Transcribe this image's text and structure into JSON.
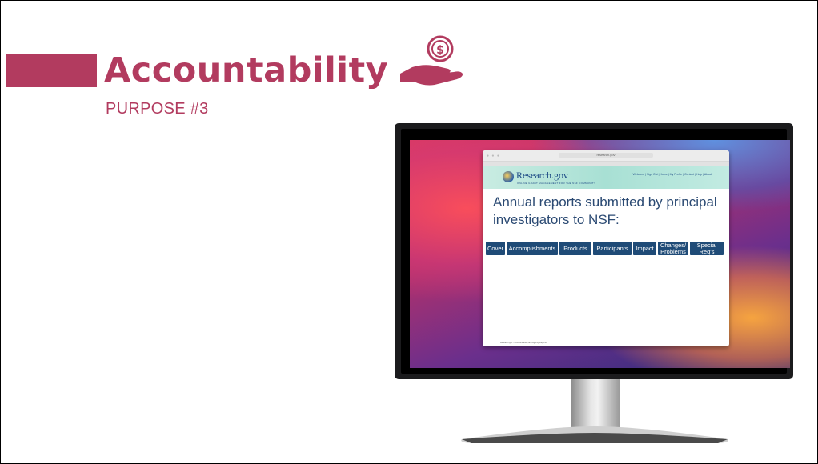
{
  "slide": {
    "title": "Accountability",
    "subtitle": "PURPOSE #3",
    "brand_color": "#b23b5f",
    "title_icon": "money-hand-icon"
  },
  "browser": {
    "url_text": "research.gov",
    "site": {
      "logo_text": "Research.gov",
      "logo_subtitle": "ONLINE GRANT MANAGEMENT FOR THE NSF COMMUNITY",
      "header_links": "Welcome | Sign Out | Home | My Profile | Contact | Help | About"
    },
    "headline": "Annual reports submitted by principal investigators to NSF:",
    "tabs": [
      {
        "label": "Cover"
      },
      {
        "label": "Accomplishments"
      },
      {
        "label": "Products"
      },
      {
        "label": "Participants"
      },
      {
        "label": "Impact"
      },
      {
        "label": "Changes/ Problems"
      },
      {
        "label": "Special Req's"
      }
    ],
    "tab_color": "#1f4b77",
    "footer_text": "Research.gov — Accountability and Agency Reports"
  }
}
